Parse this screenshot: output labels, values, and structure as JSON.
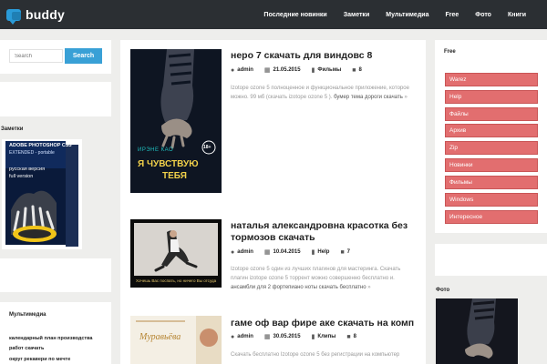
{
  "site": {
    "name": "buddy",
    "brand_color": "#2a9bd8"
  },
  "nav": [
    "Последние новинки",
    "Заметки",
    "Мультимедиа",
    "Free",
    "Фото",
    "Книги"
  ],
  "search": {
    "placeholder": "Search",
    "button": "Search"
  },
  "left_sidebar": {
    "notes_title": "Заметки",
    "notes_image": {
      "lines": [
        "ADOBE PHOTOSHOP CS3",
        "EXTENDED - portable",
        "русская версия",
        "full version"
      ]
    },
    "multimedia_title": "Мультимедиа",
    "multimedia_links": [
      "календарный план производства",
      "работ скачать",
      "округ рекавери по мечте"
    ]
  },
  "posts": [
    {
      "title": "неро 7 скачать для виндовс 8",
      "author": "admin",
      "date": "21.05.2015",
      "category": "Фильмы",
      "comments": "8",
      "excerpt": "Izotope ozone 5 полноценное и функциональное приложение, которое можно. 99 мб (скачать izotope ozone 5 ).",
      "excerpt_tail": "бумер тема дороги скачать",
      "excerpt_more": "»",
      "cover": {
        "author": "ИРЭНЕ КАО",
        "title_line1": "Я ЧУВСТВУЮ",
        "title_line2": "ТЕБЯ",
        "age": "18+"
      }
    },
    {
      "title": "наталья александровна красотка без тормозов скачать",
      "author": "admin",
      "date": "10.04.2015",
      "category": "Help",
      "comments": "7",
      "excerpt": "Izotope ozone 5 один из лучших плагинов для мастеринга. Скачать плагин izotope ozone 5 торрент можно совершенно бесплатно и.",
      "excerpt_tail": "ансамбли для 2 фортепиано ноты скачать бесплатно",
      "excerpt_more": "»",
      "caption": "Хочешь Вас поспать, но ничего Вы отсуда"
    },
    {
      "title": "гаме оф вар фире аке скачать на комп",
      "author": "admin",
      "date": "30.05.2015",
      "category": "Клипы",
      "comments": "8",
      "excerpt": "Скачать бесплатно Izotope ozone 5 без регистрации на компьютер",
      "cover": {
        "title": "Муравьёва"
      }
    }
  ],
  "right_sidebar": {
    "free_title": "Free",
    "tags": [
      "Warez",
      "Help",
      "Файлы",
      "Архив",
      "Zip",
      "Новинки",
      "Фильмы",
      "Windows",
      "Интересное"
    ],
    "tag_color": "#e26e6f",
    "photo_title": "Фото"
  },
  "icons": {
    "author": "user-icon",
    "date": "calendar-icon",
    "category": "folder-icon",
    "comments": "comments-icon"
  }
}
